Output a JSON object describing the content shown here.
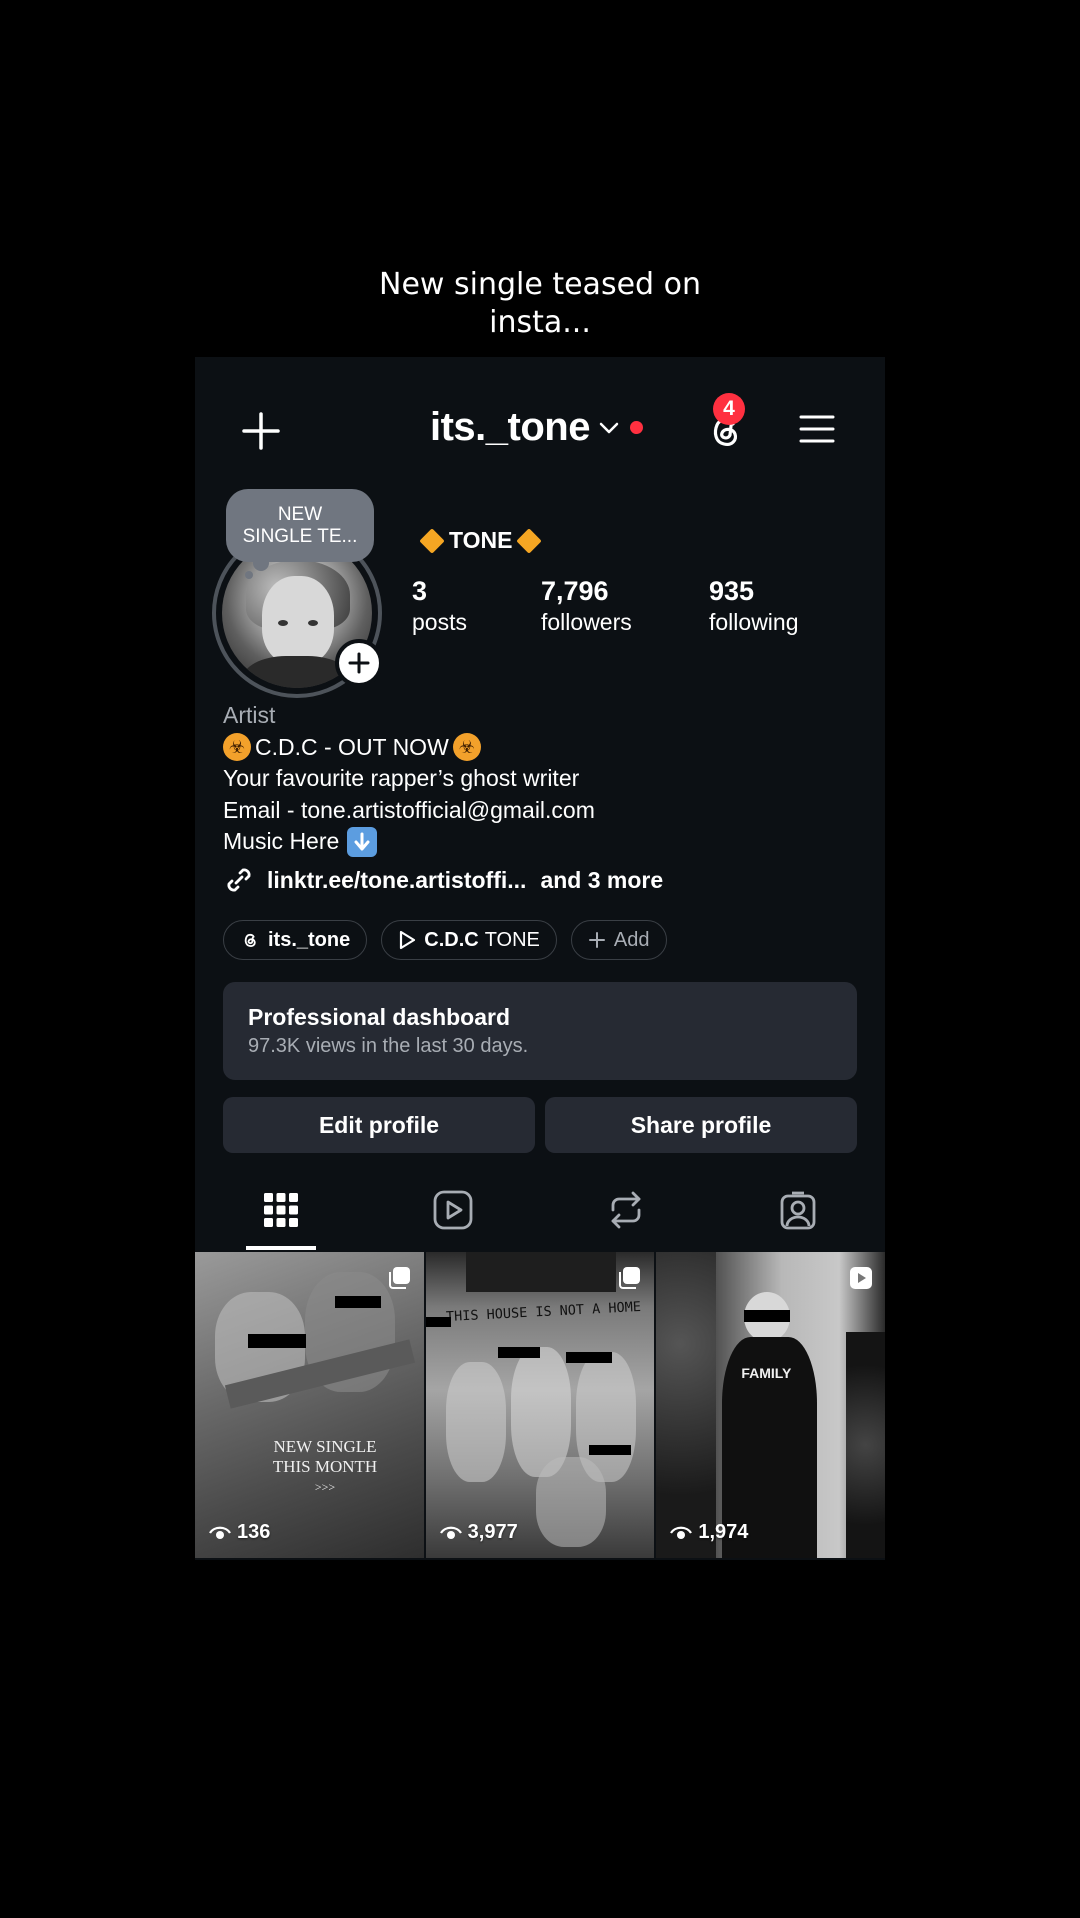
{
  "caption": {
    "line1": "New single teased on",
    "line2": "insta..."
  },
  "topbar": {
    "username": "its._tone",
    "notification_count": "4"
  },
  "profile": {
    "note_line1": "NEW",
    "note_line2": "SINGLE TE...",
    "display_name": "TONE",
    "stats": {
      "posts_count": "3",
      "posts_label": "posts",
      "followers_count": "7,796",
      "followers_label": "followers",
      "following_count": "935",
      "following_label": "following"
    },
    "category": "Artist",
    "bio_line1": "C.D.C - OUT NOW",
    "bio_line2": "Your favourite rapper’s ghost writer",
    "bio_line3": "Email - tone.artistofficial@gmail.com",
    "bio_line4": "Music Here",
    "link_text": "linktr.ee/tone.artistoffi...",
    "link_more": "and 3 more"
  },
  "chips": {
    "threads": "its._tone",
    "music_bold": "C.D.C",
    "music_rest": "TONE",
    "add": "Add"
  },
  "dashboard": {
    "title": "Professional dashboard",
    "subtitle": "97.3K views in the last 30 days."
  },
  "buttons": {
    "edit": "Edit profile",
    "share": "Share profile"
  },
  "posts": [
    {
      "views": "136",
      "text_line1": "NEW SINGLE",
      "text_line2": "THIS MONTH",
      "text_line3": ">>>"
    },
    {
      "views": "3,977",
      "text": "THIS HOUSE IS NOT A HOME"
    },
    {
      "views": "1,974",
      "text": "FAMILY"
    }
  ],
  "colors": {
    "background": "#0c1014",
    "surface": "#262a33",
    "accent_red": "#ff3040",
    "muted_text": "#a8adb4"
  }
}
